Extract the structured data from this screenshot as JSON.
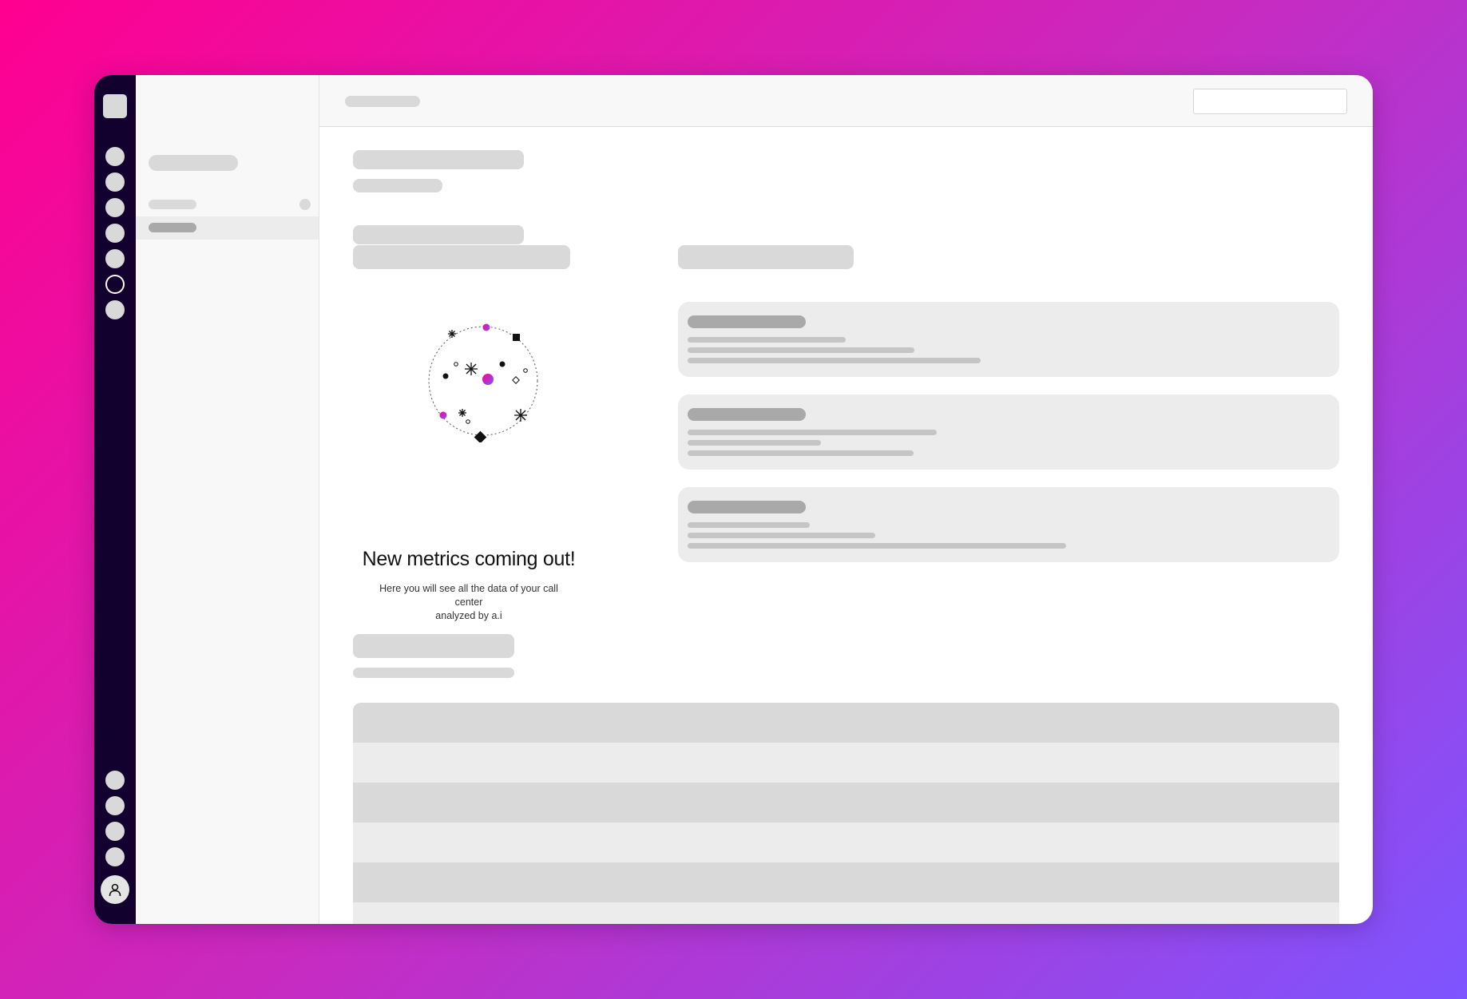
{
  "app": {
    "empty_state": {
      "title": "New metrics coming out!",
      "description_line1": "Here you will see all the data of your call center",
      "description_line2": "analyzed by a.i",
      "illustration_icon": "sparkle-orbit-icon"
    },
    "rail": {
      "logo_icon": "app-logo-icon",
      "nav_icons": [
        "nav-icon-1",
        "nav-icon-2",
        "nav-icon-3",
        "nav-icon-4",
        "nav-icon-5",
        "nav-icon-metrics",
        "nav-icon-7"
      ],
      "active_index": 5,
      "bottom_icons": [
        "nav-icon-bottom-1",
        "nav-icon-bottom-2",
        "nav-icon-bottom-3",
        "nav-icon-bottom-4"
      ],
      "avatar_icon": "user-avatar-icon"
    },
    "colors": {
      "rail_bg": "#12002e",
      "accent_pink": "#ff0090",
      "accent_purple": "#7d55ff",
      "skeleton": "#d9d9d9"
    },
    "search": {
      "placeholder": ""
    },
    "table": {
      "row_count": 6
    }
  }
}
